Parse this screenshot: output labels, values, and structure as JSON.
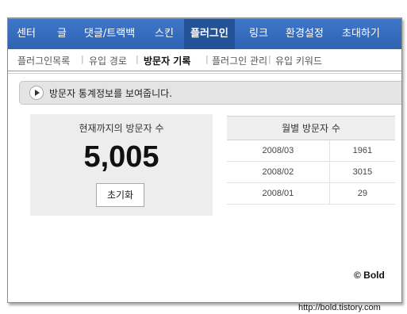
{
  "topnav": {
    "items": [
      "센터",
      "글",
      "댓글/트랙백",
      "스킨",
      "플러그인",
      "링크",
      "환경설정",
      "초대하기"
    ],
    "active": "플러그인"
  },
  "subnav": {
    "items": [
      "플러그인목록",
      "유입 경로",
      "방문자 기록",
      "플러그인 관리",
      "유입 키워드"
    ],
    "active": "방문자 기록"
  },
  "info": {
    "text": "방문자 통계정보를 보여줍니다."
  },
  "visitors": {
    "label": "현재까지의 방문자 수",
    "total": "5,005",
    "reset_label": "초기화"
  },
  "monthly": {
    "header": "월별 방문자 수",
    "rows": [
      {
        "month": "2008/03",
        "count": "1961"
      },
      {
        "month": "2008/02",
        "count": "3015"
      },
      {
        "month": "2008/01",
        "count": "29"
      }
    ]
  },
  "watermark": {
    "copyright": "© Bold",
    "url": "http://bold.tistory.com"
  },
  "colors": {
    "nav_bg": "#3366bb",
    "nav_active": "#245296"
  }
}
